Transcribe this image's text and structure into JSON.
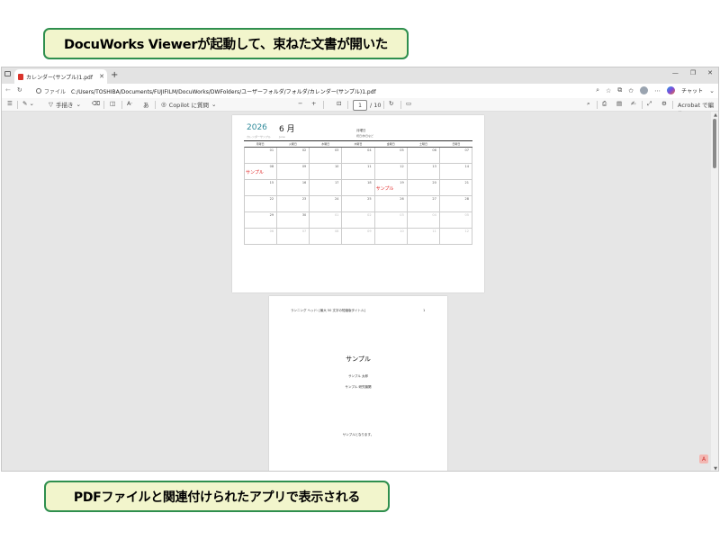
{
  "callouts": {
    "top": "DocuWorks Viewerが起動して、束ねた文書が開いた",
    "bottom": "PDFファイルと関連付けられたアプリで表示される"
  },
  "browser": {
    "tab_title": "カレンダー(サンプル)1.pdf",
    "url_scheme": "ファイル",
    "url": "C:/Users/TOSHIBA/Documents/FUJIFILM/DocuWorks/DWFolders/ユーザーフォルダ/フォルダ/カレンダー(サンプル)1.pdf",
    "chat_label": "チャット"
  },
  "pdf_toolbar": {
    "draw_label": "手描き",
    "copilot_label": "Copilot に質問",
    "current_page": "1",
    "total_pages": "/ 10",
    "acrobat_label": "Acrobat で編集"
  },
  "calendar_page": {
    "year": "2026",
    "year_sub": "カレンダーサンプル",
    "month": "6 月",
    "month_sub": "June",
    "right_line1": "月曜日",
    "right_line2": "祝日/休日など",
    "weekdays": [
      "月曜日",
      "火曜日",
      "水曜日",
      "木曜日",
      "金曜日",
      "土曜日",
      "日曜日"
    ],
    "weeks": [
      [
        "01",
        "02",
        "03",
        "04",
        "05",
        "06",
        "07"
      ],
      [
        "08",
        "09",
        "10",
        "11",
        "12",
        "13",
        "14"
      ],
      [
        "15",
        "16",
        "17",
        "18",
        "19",
        "20",
        "21"
      ],
      [
        "22",
        "23",
        "24",
        "25",
        "26",
        "27",
        "28"
      ],
      [
        "29",
        "30",
        "01",
        "02",
        "03",
        "04",
        "05"
      ],
      [
        "06",
        "07",
        "08",
        "09",
        "10",
        "11",
        "12"
      ]
    ],
    "dim_from": [
      4,
      2
    ],
    "marks": [
      {
        "text": "サンプル",
        "row": 1,
        "col": 0
      },
      {
        "text": "サンプル",
        "row": 2,
        "col": 4
      }
    ]
  },
  "doc_page": {
    "header": "ランニング ヘッド: [最大 50 文字の短縮版タイトル]",
    "page_number": "1",
    "title": "サンプル",
    "author": "サンプル 太郎",
    "institution": "サンプル 研究機関",
    "note": "サンプルとなります。"
  }
}
